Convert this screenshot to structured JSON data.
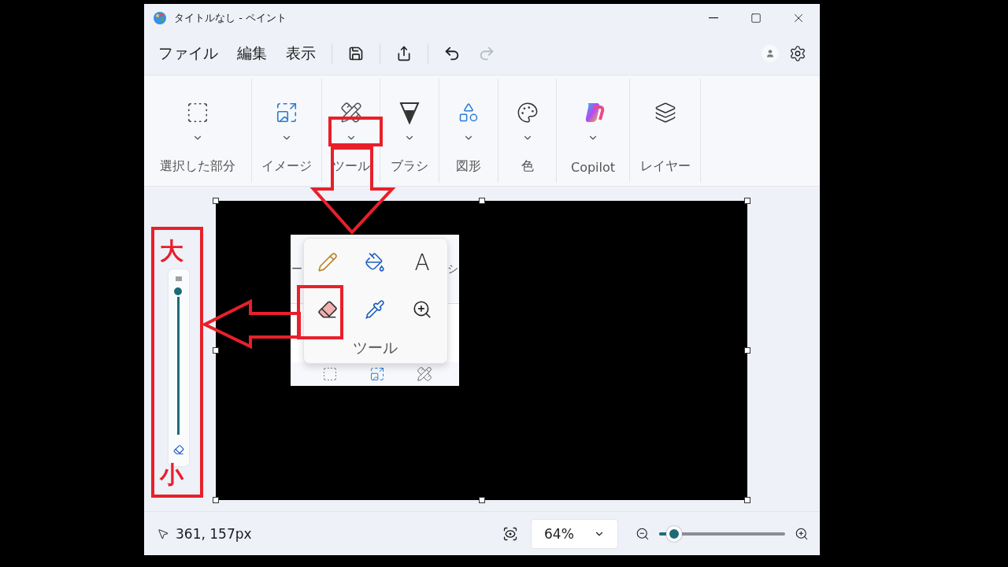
{
  "window": {
    "title": "タイトルなし - ペイント"
  },
  "menu": [
    "ファイル",
    "編集",
    "表示"
  ],
  "quick_actions": [
    {
      "kind": "save",
      "disabled": false
    },
    {
      "kind": "share",
      "disabled": false
    },
    {
      "kind": "undo",
      "disabled": false
    },
    {
      "kind": "redo",
      "disabled": true
    }
  ],
  "ribbon": [
    {
      "kind": "selection",
      "label": "選択した部分",
      "dropdown": true
    },
    {
      "kind": "image",
      "label": "イメージ",
      "dropdown": true
    },
    {
      "kind": "tools",
      "label": "ツール",
      "dropdown": true
    },
    {
      "kind": "brush",
      "label": "ブラシ",
      "dropdown": true
    },
    {
      "kind": "shapes",
      "label": "図形",
      "dropdown": true
    },
    {
      "kind": "colors",
      "label": "色",
      "dropdown": true
    },
    {
      "kind": "copilot",
      "label": "Copilot",
      "dropdown": true
    },
    {
      "kind": "layers",
      "label": "レイヤー",
      "dropdown": false
    }
  ],
  "brush_size": {
    "level": 1,
    "large_label": "大",
    "small_label": "小"
  },
  "tools_popup": {
    "title": "ツール",
    "background_fragments": [
      "ー",
      "シ"
    ],
    "tools": [
      {
        "kind": "pencil"
      },
      {
        "kind": "fill"
      },
      {
        "kind": "text",
        "glyph": "A"
      },
      {
        "kind": "eraser"
      },
      {
        "kind": "picker"
      },
      {
        "kind": "magnifier"
      }
    ]
  },
  "status_bar": {
    "position": "361, 157px",
    "zoom": "64%",
    "zoom_slider": {
      "level": 0.12
    }
  }
}
